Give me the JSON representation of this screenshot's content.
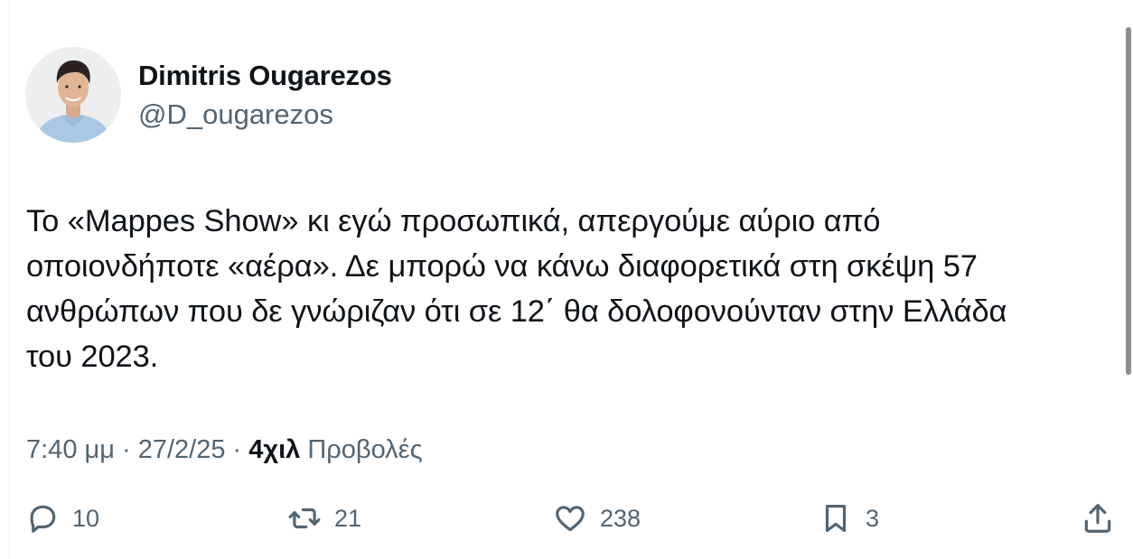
{
  "author": {
    "display_name": "Dimitris Ougarezos",
    "handle": "@D_ougarezos"
  },
  "tweet": {
    "lines": [
      "Το «Mappes Show» κι εγώ προσωπικά, απεργούμε αύριο από",
      "οποιονδήποτε «αέρα». Δε μπορώ να κάνω διαφορετικά στη σκέψη 57",
      "ανθρώπων που δε γνώριζαν ότι σε 12΄ θα δολοφονούνταν στην Ελλάδα",
      "του 2023."
    ]
  },
  "meta": {
    "time": "7:40 μμ",
    "separator": "·",
    "date": "27/2/25",
    "views_count": "4χιλ",
    "views_label": "Προβολές"
  },
  "actions": {
    "replies": "10",
    "reposts": "21",
    "likes": "238",
    "bookmarks": "3"
  },
  "icons": {
    "reply": "reply-icon",
    "repost": "repost-icon",
    "like": "heart-icon",
    "bookmark": "bookmark-icon",
    "share": "share-icon"
  },
  "colors": {
    "text": "#0f1419",
    "secondary": "#536471"
  }
}
